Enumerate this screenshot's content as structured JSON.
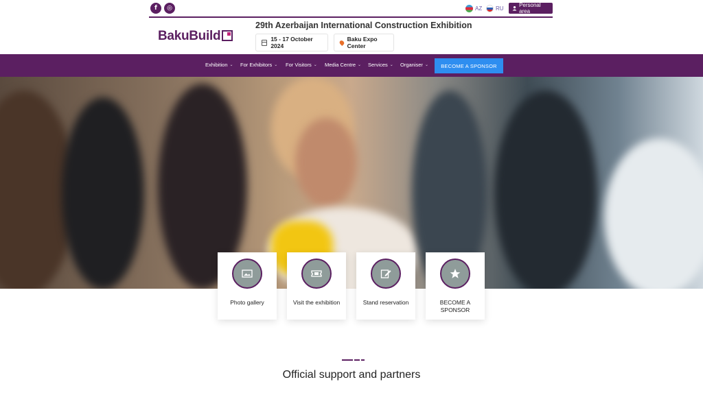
{
  "social": {
    "facebook_glyph": "f",
    "instagram_glyph": "◎"
  },
  "languages": [
    {
      "code": "AZ"
    },
    {
      "code": "RU"
    }
  ],
  "personal_area": {
    "label": "Personal area"
  },
  "logo": {
    "text": "BakuBuild"
  },
  "exhibition": {
    "title": "29th Azerbaijan International Construction Exhibition",
    "dates": "15 - 17 October 2024",
    "venue": "Baku Expo Center"
  },
  "nav": {
    "items": [
      {
        "label": "Exhibition"
      },
      {
        "label": "For Exhibitors"
      },
      {
        "label": "For Visitors"
      },
      {
        "label": "Media Centre"
      },
      {
        "label": "Services"
      },
      {
        "label": "Organiser"
      }
    ],
    "sponsor_button": "BECOME A SPONSOR"
  },
  "cards": [
    {
      "label": "Photo gallery",
      "icon": "image-icon"
    },
    {
      "label": "Visit the exhibition",
      "icon": "ticket-icon"
    },
    {
      "label": "Stand reservation",
      "icon": "edit-icon"
    },
    {
      "label": "BECOME A SPONSOR",
      "icon": "star-icon"
    }
  ],
  "section": {
    "title": "Official support and partners"
  },
  "colors": {
    "brand": "#5b1f61",
    "accent": "#2e8ef0",
    "pin": "#e8702a"
  }
}
